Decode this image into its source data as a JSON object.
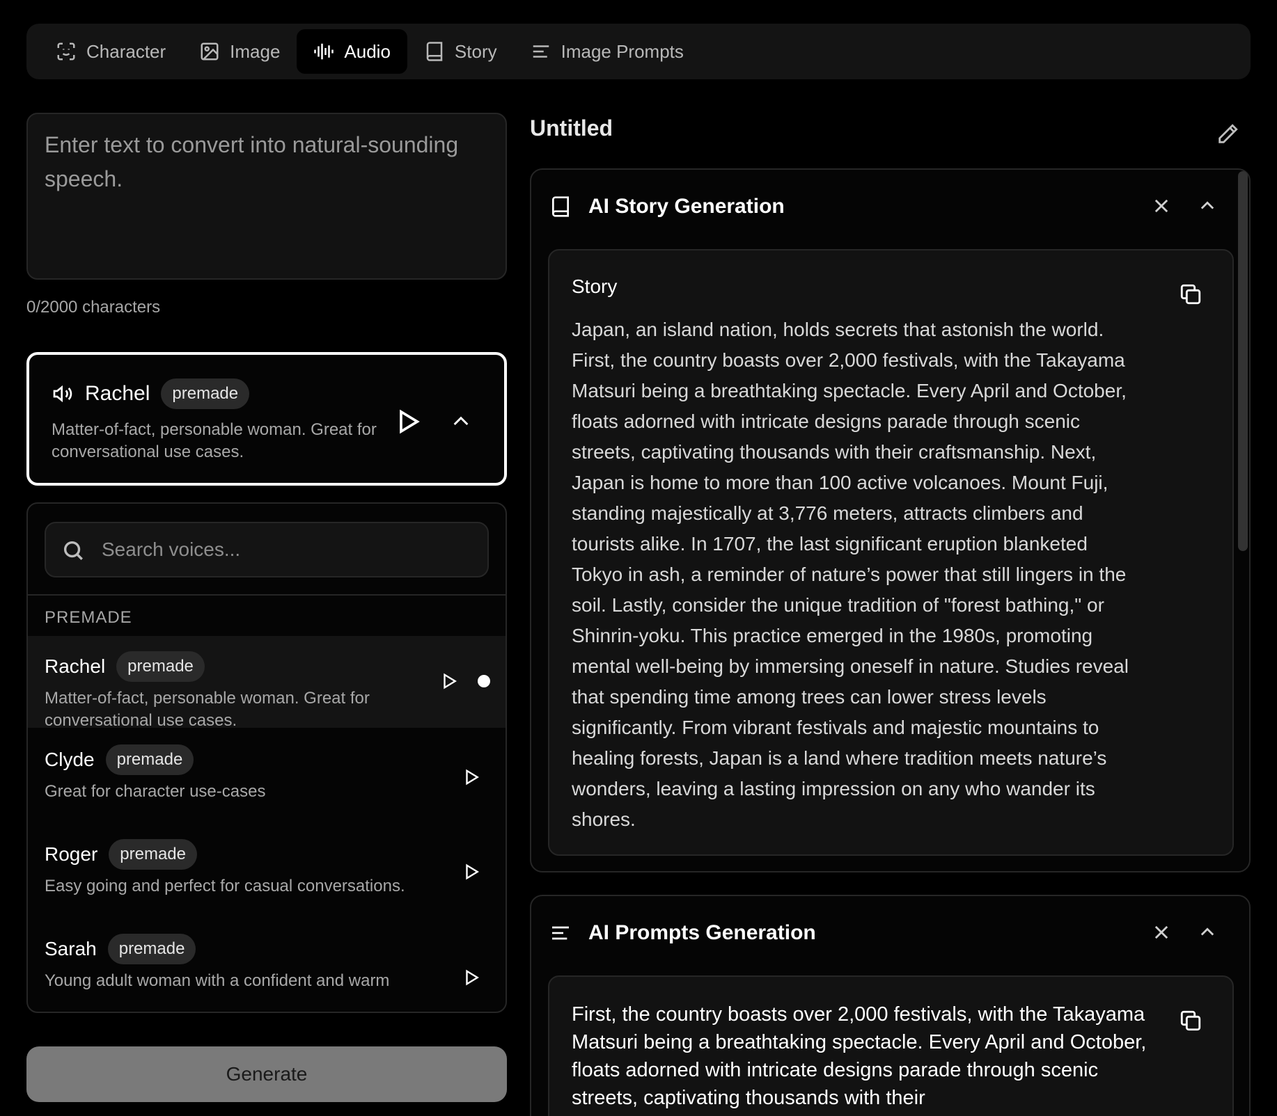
{
  "tabs": [
    {
      "label": "Character",
      "icon": "face-scan-icon",
      "active": false
    },
    {
      "label": "Image",
      "icon": "image-icon",
      "active": false
    },
    {
      "label": "Audio",
      "icon": "audio-waveform-icon",
      "active": true
    },
    {
      "label": "Story",
      "icon": "book-icon",
      "active": false
    },
    {
      "label": "Image Prompts",
      "icon": "lines-icon",
      "active": false
    }
  ],
  "input": {
    "placeholder": "Enter text to convert into natural-sounding speech.",
    "value": "",
    "char_count": "0/2000 characters"
  },
  "selected_voice": {
    "name": "Rachel",
    "badge": "premade",
    "description": "Matter-of-fact, personable woman. Great for conversational use cases."
  },
  "voice_list": {
    "search_placeholder": "Search voices...",
    "section_label": "PREMADE",
    "voices": [
      {
        "name": "Rachel",
        "badge": "premade",
        "description": "Matter-of-fact, personable woman. Great for conversational use cases.",
        "selected": true
      },
      {
        "name": "Clyde",
        "badge": "premade",
        "description": "Great for character use-cases",
        "selected": false
      },
      {
        "name": "Roger",
        "badge": "premade",
        "description": "Easy going and perfect for casual conversations.",
        "selected": false
      },
      {
        "name": "Sarah",
        "badge": "premade",
        "description": "Young adult woman with a confident and warm",
        "selected": false
      }
    ]
  },
  "generate_label": "Generate",
  "document": {
    "title": "Untitled"
  },
  "story_panel": {
    "title": "AI Story Generation",
    "card_label": "Story",
    "text": "Japan, an island nation, holds secrets that astonish the world. First, the country boasts over 2,000 festivals, with the Takayama Matsuri being a breathtaking spectacle. Every April and October, floats adorned with intricate designs parade through scenic streets, captivating thousands with their craftsmanship. Next, Japan is home to more than 100 active volcanoes. Mount Fuji, standing majestically at 3,776 meters, attracts climbers and tourists alike. In 1707, the last significant eruption blanketed Tokyo in ash, a reminder of nature’s power that still lingers in the soil. Lastly, consider the unique tradition of \"forest bathing,\" or Shinrin-yoku. This practice emerged in the 1980s, promoting mental well-being by immersing oneself in nature. Studies reveal that spending time among trees can lower stress levels significantly. From vibrant festivals and majestic mountains to healing forests, Japan is a land where tradition meets nature’s wonders, leaving a lasting impression on any who wander its shores."
  },
  "prompts_panel": {
    "title": "AI Prompts Generation",
    "text": "First, the country boasts over 2,000 festivals, with the Takayama Matsuri being a breathtaking spectacle. Every April and October, floats adorned with intricate designs parade through scenic streets, captivating thousands with their"
  },
  "colors": {
    "background": "#000000",
    "surface": "#141414",
    "border": "#262626",
    "generate_button": "#7a7a7a"
  }
}
